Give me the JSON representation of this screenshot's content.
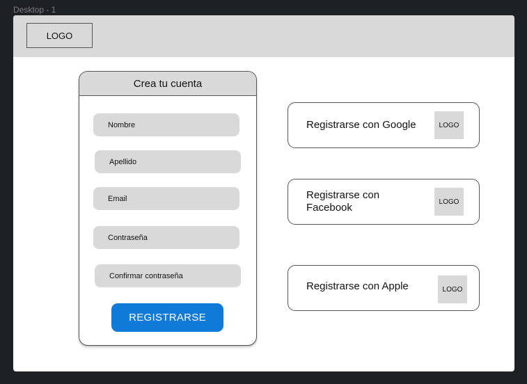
{
  "frame": {
    "label": "Desktop - 1"
  },
  "header": {
    "logo": "LOGO"
  },
  "signup": {
    "title": "Crea tu cuenta",
    "fields": {
      "first_name": "Nombre",
      "last_name": "Apellido",
      "email": "Email",
      "password": "Contraseña",
      "confirm_password": "Confirmar contraseña"
    },
    "submit": "REGISTRARSE"
  },
  "social": {
    "google": {
      "label": "Registrarse con Google",
      "logo": "LOGO"
    },
    "facebook": {
      "label": "Registrarse con Facebook",
      "logo": "LOGO"
    },
    "apple": {
      "label": "Registrarse con Apple",
      "logo": "LOGO"
    }
  },
  "colors": {
    "canvas": "#1e2124",
    "placeholder_gray": "#d9d9d9",
    "primary": "#0f7ad8"
  }
}
